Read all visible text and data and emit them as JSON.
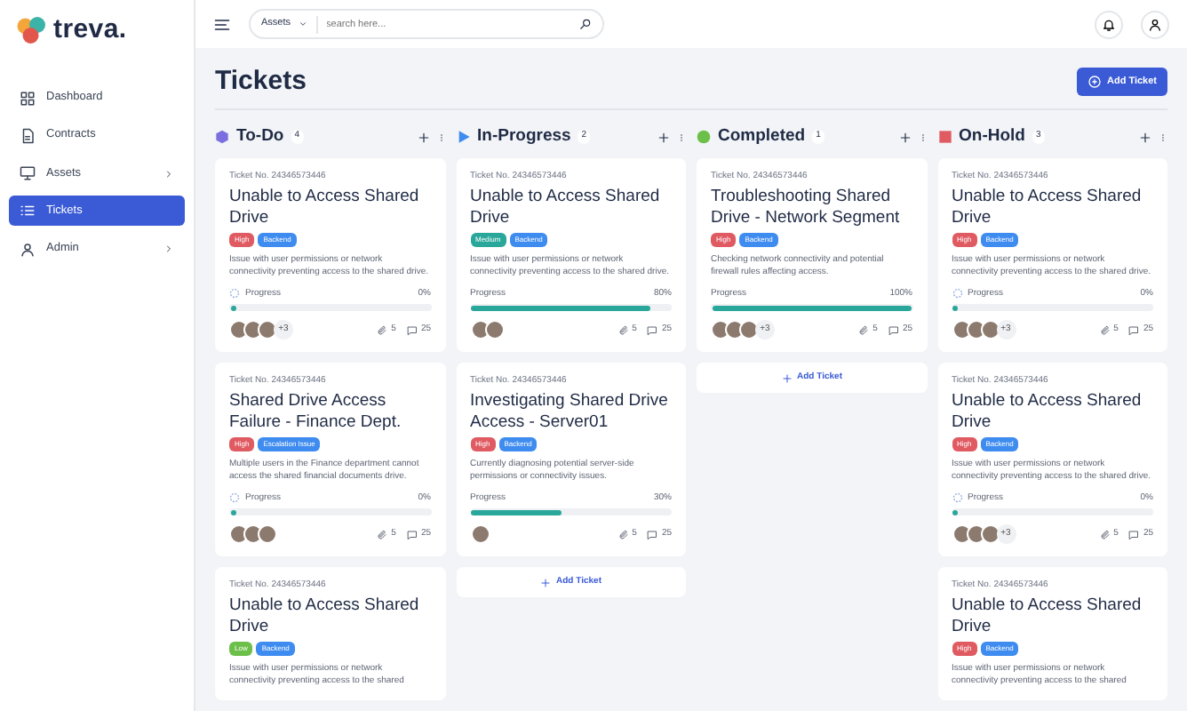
{
  "sidebar": {
    "logo": "treva.",
    "items": [
      {
        "label": "Dashboard",
        "has_submenu": false,
        "selected": false
      },
      {
        "label": "Contracts",
        "has_submenu": false,
        "selected": false
      },
      {
        "label": "Assets",
        "has_submenu": true,
        "selected": false
      },
      {
        "label": "Tickets",
        "has_submenu": false,
        "selected": true
      },
      {
        "label": "Admin",
        "has_submenu": true,
        "selected": false
      }
    ]
  },
  "header": {
    "search_scope": "Assets",
    "search": {
      "placeholder": "search here..."
    }
  },
  "page": {
    "title": "Tickets",
    "add_button": "Add Ticket"
  },
  "columns": [
    {
      "name": "To-Do",
      "count": "4",
      "kind": "hexagon",
      "color": "#7b6fe0",
      "cards": [
        {
          "ticket_no": "Ticket No. 24346573446",
          "title": "Unable to Access Shared Drive",
          "tags": [
            {
              "label": "High",
              "color": "#e05a62"
            },
            {
              "label": "Backend",
              "color": "#3f8cf0"
            }
          ],
          "description": "Issue with user permissions or network connectivity preventing access to the shared drive.",
          "progress_label": "Progress",
          "reading": "0%",
          "level": 0,
          "avatars": [
            {
              "kind": "photo"
            },
            {
              "kind": "photo"
            },
            {
              "kind": "photo"
            }
          ],
          "more": "+3",
          "attachments": "5",
          "comments": "25"
        },
        {
          "ticket_no": "Ticket No. 24346573446",
          "title": "Shared Drive Access Failure - Finance Dept.",
          "tags": [
            {
              "label": "High",
              "color": "#e05a62"
            },
            {
              "label": "Escalation Issue",
              "color": "#3f8cf0"
            }
          ],
          "description": "Multiple users in the Finance department cannot access the shared financial documents drive.",
          "progress_label": "Progress",
          "reading": "0%",
          "level": 0,
          "avatars": [
            {
              "kind": "photo"
            },
            {
              "kind": "photo"
            },
            {
              "kind": "photo"
            }
          ],
          "attachments": "5",
          "comments": "25"
        },
        {
          "ticket_no": "Ticket No. 24346573446",
          "title": "Unable to Access Shared Drive",
          "tags": [
            {
              "label": "Low",
              "color": "#6cc04a"
            },
            {
              "label": "Backend",
              "color": "#3f8cf0"
            }
          ],
          "description": "Issue with user permissions or network connectivity preventing access to the shared"
        }
      ]
    },
    {
      "name": "In-Progress",
      "count": "2",
      "kind": "triangle",
      "color": "#3f8cf0",
      "add_ticket": "Add Ticket",
      "cards": [
        {
          "ticket_no": "Ticket No. 24346573446",
          "title": "Unable to Access Shared Drive",
          "tags": [
            {
              "label": "Medium",
              "color": "#2aa79b"
            },
            {
              "label": "Backend",
              "color": "#3f8cf0"
            }
          ],
          "description": "Issue with user permissions or network connectivity preventing access to the shared drive.",
          "progress_label": "Progress",
          "reading": "80%",
          "level": 0.9,
          "avatars": [
            {
              "kind": "photo"
            },
            {
              "kind": "photo"
            }
          ],
          "attachments": "5",
          "comments": "25"
        },
        {
          "ticket_no": "Ticket No. 24346573446",
          "title": "Investigating Shared Drive Access - Server01",
          "tags": [
            {
              "label": "High",
              "color": "#e05a62"
            },
            {
              "label": "Backend",
              "color": "#3f8cf0"
            }
          ],
          "description": "Currently diagnosing potential server-side permissions or connectivity issues.",
          "progress_label": "Progress",
          "reading": "30%",
          "level": 0.45,
          "avatars": [
            {
              "kind": "photo"
            }
          ],
          "attachments": "5",
          "comments": "25"
        }
      ]
    },
    {
      "name": "Completed",
      "count": "1",
      "kind": "circle",
      "color": "#6cc04a",
      "add_ticket": "Add Ticket",
      "cards": [
        {
          "ticket_no": "Ticket No. 24346573446",
          "title": "Troubleshooting Shared Drive - Network Segment",
          "tags": [
            {
              "label": "High",
              "color": "#e05a62"
            },
            {
              "label": "Backend",
              "color": "#3f8cf0"
            }
          ],
          "description": "Checking network connectivity and potential firewall rules affecting access.",
          "progress_label": "Progress",
          "reading": "100%",
          "level": 1,
          "avatars": [
            {
              "kind": "photo"
            },
            {
              "kind": "photo"
            },
            {
              "kind": "photo"
            }
          ],
          "more": "+3",
          "attachments": "5",
          "comments": "25"
        }
      ]
    },
    {
      "name": "On-Hold",
      "count": "3",
      "kind": "square",
      "color": "#e05a62",
      "cards": [
        {
          "ticket_no": "Ticket No. 24346573446",
          "title": "Unable to Access Shared Drive",
          "tags": [
            {
              "label": "High",
              "color": "#e05a62"
            },
            {
              "label": "Backend",
              "color": "#3f8cf0"
            }
          ],
          "description": "Issue with user permissions or network connectivity preventing access to the shared drive.",
          "progress_label": "Progress",
          "reading": "0%",
          "level": 0,
          "avatars": [
            {
              "kind": "photo"
            },
            {
              "kind": "photo"
            },
            {
              "kind": "photo"
            }
          ],
          "more": "+3",
          "attachments": "5",
          "comments": "25"
        },
        {
          "ticket_no": "Ticket No. 24346573446",
          "title": "Unable to Access Shared Drive",
          "tags": [
            {
              "label": "High",
              "color": "#e05a62"
            },
            {
              "label": "Backend",
              "color": "#3f8cf0"
            }
          ],
          "description": "Issue with user permissions or network connectivity preventing access to the shared drive.",
          "progress_label": "Progress",
          "reading": "0%",
          "level": 0,
          "avatars": [
            {
              "kind": "photo"
            },
            {
              "kind": "photo"
            },
            {
              "kind": "photo"
            }
          ],
          "more": "+3",
          "attachments": "5",
          "comments": "25"
        },
        {
          "ticket_no": "Ticket No. 24346573446",
          "title": "Unable to Access Shared Drive",
          "tags": [
            {
              "label": "High",
              "color": "#e05a62"
            },
            {
              "label": "Backend",
              "color": "#3f8cf0"
            }
          ],
          "description": "Issue with user permissions or network connectivity preventing access to the shared"
        }
      ]
    }
  ]
}
